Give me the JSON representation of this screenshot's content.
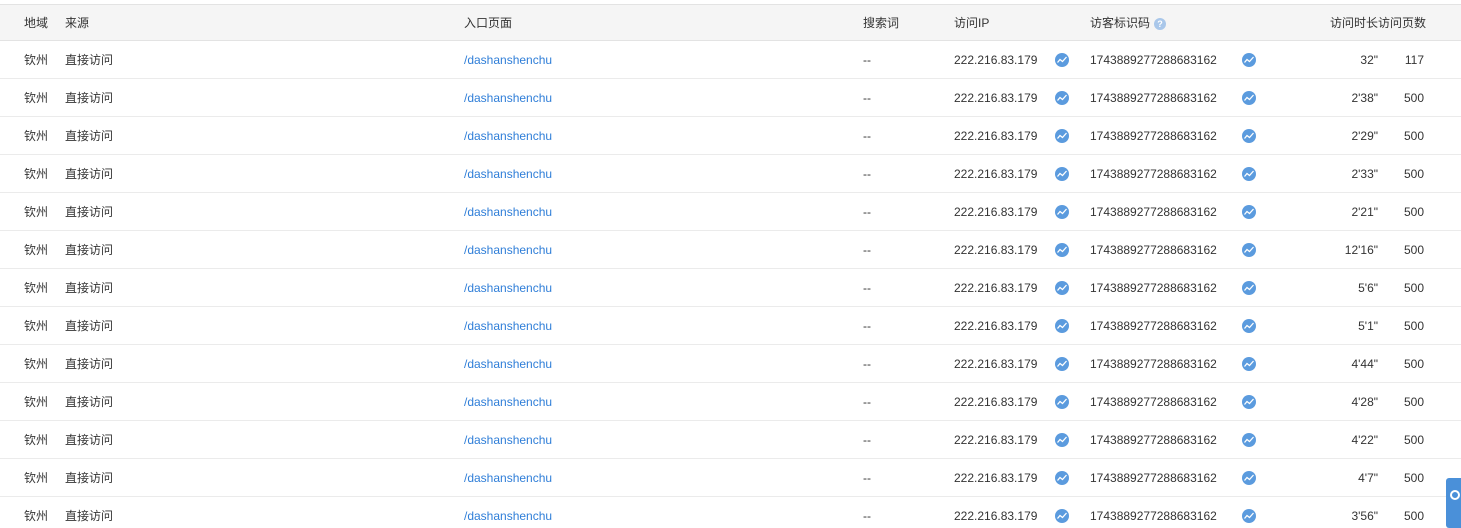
{
  "table": {
    "headers": {
      "region": "地域",
      "source": "来源",
      "entry_page": "入口页面",
      "search_term": "搜索词",
      "visitor_ip": "访问IP",
      "visitor_id": "访客标识码",
      "visitor_id_help": "?",
      "duration": "访问时长",
      "page_count": "访问页数"
    },
    "rows": [
      {
        "region": "钦州",
        "source": "直接访问",
        "entry_page": "/dashanshenchu",
        "search_term": "--",
        "ip": "222.216.83.179",
        "visitor_id": "1743889277288683162",
        "duration": "32\"",
        "pages": "117"
      },
      {
        "region": "钦州",
        "source": "直接访问",
        "entry_page": "/dashanshenchu",
        "search_term": "--",
        "ip": "222.216.83.179",
        "visitor_id": "1743889277288683162",
        "duration": "2'38\"",
        "pages": "500"
      },
      {
        "region": "钦州",
        "source": "直接访问",
        "entry_page": "/dashanshenchu",
        "search_term": "--",
        "ip": "222.216.83.179",
        "visitor_id": "1743889277288683162",
        "duration": "2'29\"",
        "pages": "500"
      },
      {
        "region": "钦州",
        "source": "直接访问",
        "entry_page": "/dashanshenchu",
        "search_term": "--",
        "ip": "222.216.83.179",
        "visitor_id": "1743889277288683162",
        "duration": "2'33\"",
        "pages": "500"
      },
      {
        "region": "钦州",
        "source": "直接访问",
        "entry_page": "/dashanshenchu",
        "search_term": "--",
        "ip": "222.216.83.179",
        "visitor_id": "1743889277288683162",
        "duration": "2'21\"",
        "pages": "500"
      },
      {
        "region": "钦州",
        "source": "直接访问",
        "entry_page": "/dashanshenchu",
        "search_term": "--",
        "ip": "222.216.83.179",
        "visitor_id": "1743889277288683162",
        "duration": "12'16\"",
        "pages": "500"
      },
      {
        "region": "钦州",
        "source": "直接访问",
        "entry_page": "/dashanshenchu",
        "search_term": "--",
        "ip": "222.216.83.179",
        "visitor_id": "1743889277288683162",
        "duration": "5'6\"",
        "pages": "500"
      },
      {
        "region": "钦州",
        "source": "直接访问",
        "entry_page": "/dashanshenchu",
        "search_term": "--",
        "ip": "222.216.83.179",
        "visitor_id": "1743889277288683162",
        "duration": "5'1\"",
        "pages": "500"
      },
      {
        "region": "钦州",
        "source": "直接访问",
        "entry_page": "/dashanshenchu",
        "search_term": "--",
        "ip": "222.216.83.179",
        "visitor_id": "1743889277288683162",
        "duration": "4'44\"",
        "pages": "500"
      },
      {
        "region": "钦州",
        "source": "直接访问",
        "entry_page": "/dashanshenchu",
        "search_term": "--",
        "ip": "222.216.83.179",
        "visitor_id": "1743889277288683162",
        "duration": "4'28\"",
        "pages": "500"
      },
      {
        "region": "钦州",
        "source": "直接访问",
        "entry_page": "/dashanshenchu",
        "search_term": "--",
        "ip": "222.216.83.179",
        "visitor_id": "1743889277288683162",
        "duration": "4'22\"",
        "pages": "500"
      },
      {
        "region": "钦州",
        "source": "直接访问",
        "entry_page": "/dashanshenchu",
        "search_term": "--",
        "ip": "222.216.83.179",
        "visitor_id": "1743889277288683162",
        "duration": "4'7\"",
        "pages": "500"
      },
      {
        "region": "钦州",
        "source": "直接访问",
        "entry_page": "/dashanshenchu",
        "search_term": "--",
        "ip": "222.216.83.179",
        "visitor_id": "1743889277288683162",
        "duration": "3'56\"",
        "pages": "500"
      }
    ]
  },
  "icons": {
    "row_ip_icon": "trend-chart-icon",
    "row_visitor_icon": "trend-chart-icon",
    "header_help_icon": "question-icon",
    "side_tab_icon": "feedback-icon"
  },
  "colors": {
    "link": "#2f7ed8",
    "icon_blue": "#5b9bde",
    "header_bg": "#f5f5f5",
    "side_tab": "#4a90d9"
  }
}
